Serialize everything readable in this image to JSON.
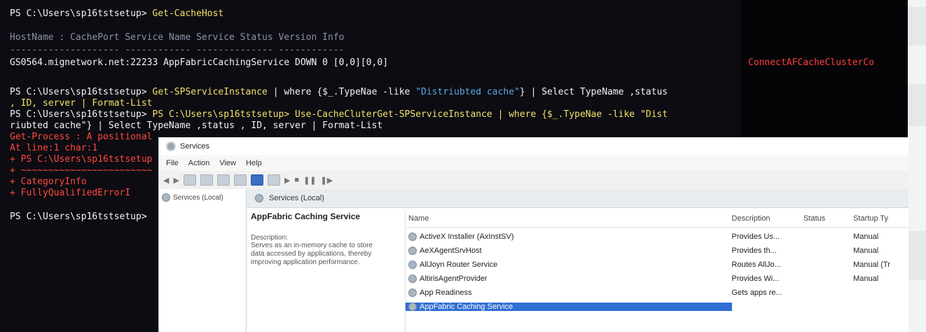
{
  "terminal": {
    "lines": [
      {
        "prompt": "PS C:\\Users\\sp16tstsetup>",
        "cmd": "Get-CacheHost"
      },
      {
        "text": "HostName : CachePort       Service Name                      Service Status Version Info"
      },
      {
        "text": "--------------------       ------------                      -------------- ------------"
      },
      {
        "text": "GS0564.mignetwork.net:22233 AppFabricCachingService DOWN            0 [0,0][0,0]"
      },
      {
        "prompt": "PS C:\\Users\\sp16tstsetup>",
        "cmd": "Get-SPServiceInstance",
        "rest": " | where {$_.TypeNae -like ",
        "str": "\"Distriubted cache\"",
        "rest2": "} | Select TypeName ,status"
      },
      {
        "text": ", ID, server | Format-List"
      },
      {
        "prompt": "PS C:\\Users\\sp16tstsetup>",
        "cmd": "PS C:\\Users\\sp16tstsetup> Use-CacheCluterGet-SPServiceInstance | where {$_.TypeNae -like \"Dist"
      },
      {
        "text": "riubted cache\"} | Select TypeName ,status , ID, server | Format-List"
      },
      {
        "text": "Get-Process : A positional"
      },
      {
        "text": "At line:1 char:1"
      },
      {
        "text": "+ PS C:\\Users\\sp16tstsetup"
      },
      {
        "text": "+ ~~~~~~~~~~~~~~~~~~~~~~~~"
      },
      {
        "text": "    + CategoryInfo"
      },
      {
        "text": "    + FullyQualifiedErrorI"
      },
      {
        "prompt": "PS C:\\Users\\sp16tstsetup>"
      }
    ]
  },
  "right_terminal": {
    "error_text": "ConnectAFCacheClusterCo"
  },
  "services": {
    "title": "Services",
    "menu": [
      "File",
      "Action",
      "View",
      "Help"
    ],
    "tree_root": "Services (Local)",
    "panel_header": "Services (Local)",
    "selected_name": "AppFabric Caching Service",
    "description_label": "Description:",
    "description_text": "Serves as an in-memory cache to store data accessed by applications, thereby improving application performance.",
    "columns": {
      "name": "Name",
      "description": "Description",
      "status": "Status",
      "startup": "Startup Ty"
    },
    "rows": [
      {
        "name": "ActiveX Installer (AxInstSV)",
        "description": "Provides Us...",
        "status": "",
        "startup": "Manual",
        "selected": false
      },
      {
        "name": "AeXAgentSrvHost",
        "description": "Provides th...",
        "status": "",
        "startup": "Manual",
        "selected": false
      },
      {
        "name": "AllJoyn Router Service",
        "description": "Routes AllJo...",
        "status": "",
        "startup": "Manual (Tr",
        "selected": false
      },
      {
        "name": "AltirisAgentProvider",
        "description": "Provides Wi...",
        "status": "",
        "startup": "Manual",
        "selected": false
      },
      {
        "name": "App Readiness",
        "description": "Gets apps re...",
        "status": "",
        "startup": "",
        "selected": false
      },
      {
        "name": "AppFabric Caching Service",
        "description": "",
        "status": "",
        "startup": "",
        "selected": true
      }
    ]
  }
}
